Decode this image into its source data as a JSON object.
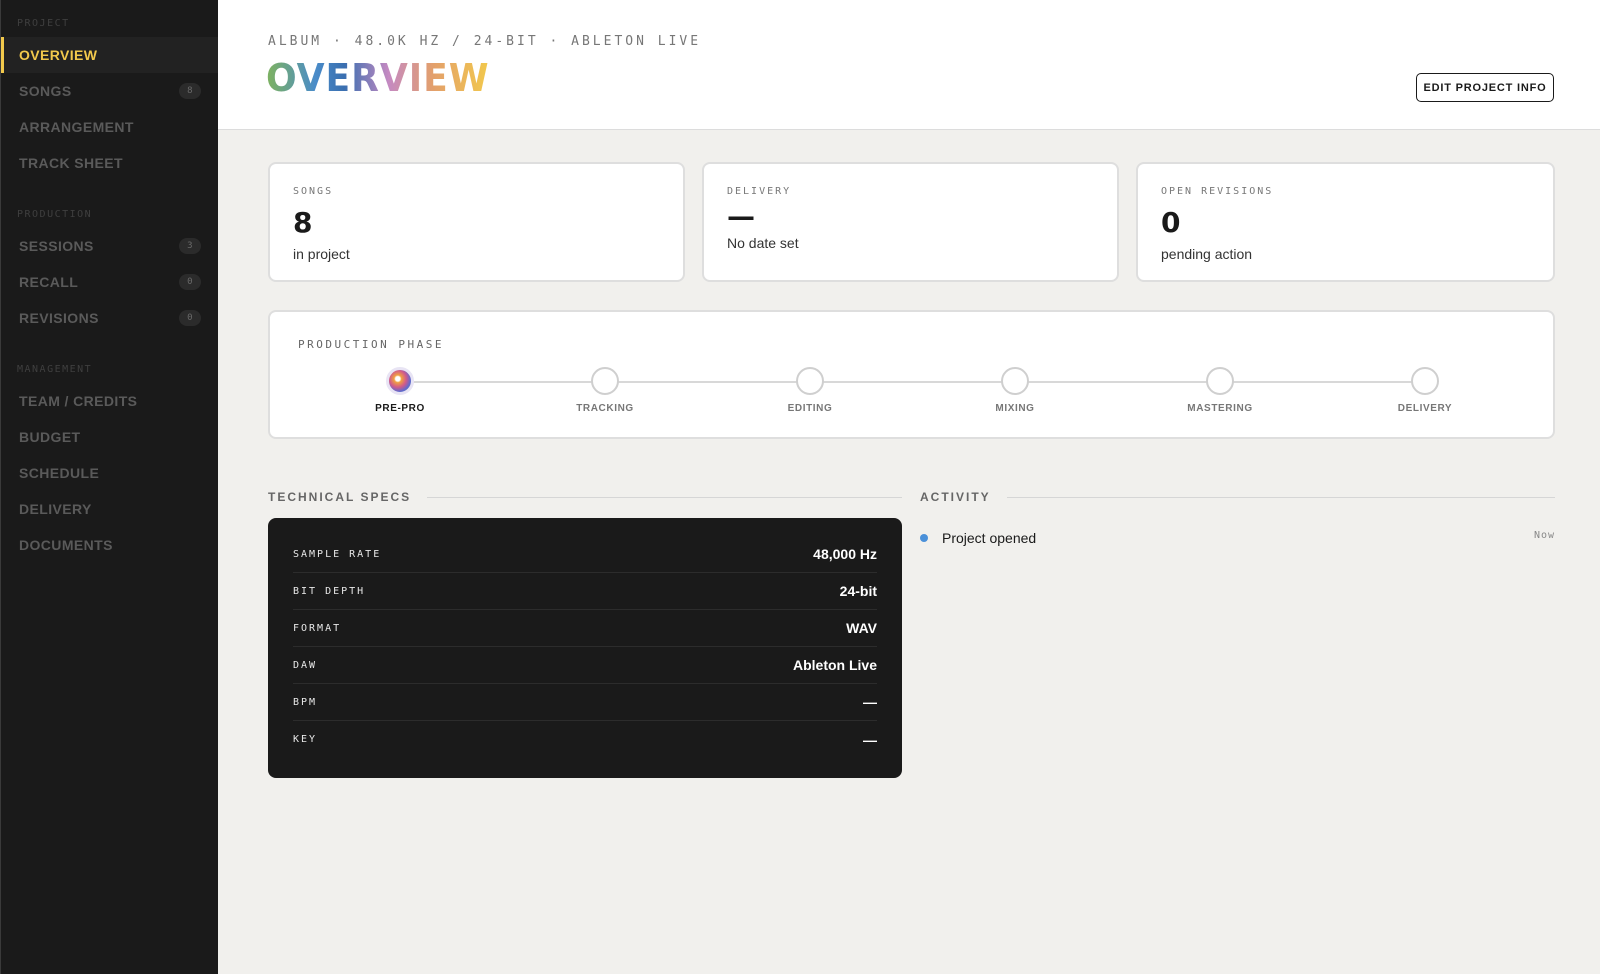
{
  "sidebar": {
    "sections": [
      {
        "label": "PROJECT"
      },
      {
        "label": "PRODUCTION"
      },
      {
        "label": "MANAGEMENT"
      }
    ],
    "items": [
      {
        "label": "OVERVIEW",
        "badge": "",
        "active": true
      },
      {
        "label": "SONGS",
        "badge": "8"
      },
      {
        "label": "ARRANGEMENT",
        "badge": ""
      },
      {
        "label": "TRACK SHEET",
        "badge": ""
      },
      {
        "label": "SESSIONS",
        "badge": "3"
      },
      {
        "label": "RECALL",
        "badge": "0"
      },
      {
        "label": "REVISIONS",
        "badge": "0"
      },
      {
        "label": "TEAM / CREDITS",
        "badge": ""
      },
      {
        "label": "BUDGET",
        "badge": ""
      },
      {
        "label": "SCHEDULE",
        "badge": ""
      },
      {
        "label": "DELIVERY",
        "badge": ""
      },
      {
        "label": "DOCUMENTS",
        "badge": ""
      }
    ]
  },
  "header": {
    "subtitle": "ALBUM · 48.0K HZ / 24-BIT · ABLETON LIVE",
    "title": "OVERVIEW",
    "edit_button": "EDIT PROJECT INFO"
  },
  "stats": [
    {
      "label": "SONGS",
      "value": "8",
      "sub": "in project"
    },
    {
      "label": "DELIVERY",
      "value": "—",
      "sub": "No date set"
    },
    {
      "label": "OPEN REVISIONS",
      "value": "0",
      "sub": "pending action"
    }
  ],
  "phase": {
    "label": "PRODUCTION PHASE",
    "current": "PRE-PRO",
    "steps": [
      "PRE-PRO",
      "TRACKING",
      "EDITING",
      "MIXING",
      "MASTERING",
      "DELIVERY"
    ]
  },
  "specs": {
    "heading": "TECHNICAL SPECS",
    "rows": [
      {
        "key": "SAMPLE RATE",
        "value": "48,000 Hz"
      },
      {
        "key": "BIT DEPTH",
        "value": "24-bit"
      },
      {
        "key": "FORMAT",
        "value": "WAV"
      },
      {
        "key": "DAW",
        "value": "Ableton Live"
      },
      {
        "key": "BPM",
        "value": "—"
      },
      {
        "key": "KEY",
        "value": "—"
      }
    ]
  },
  "activity": {
    "heading": "ACTIVITY",
    "items": [
      {
        "text": "Project opened",
        "time": "Now"
      }
    ]
  },
  "colors": {
    "accent": "#f2c94c",
    "sidebar_bg": "#1a1a1a",
    "activity_dot": "#4a90d9"
  }
}
